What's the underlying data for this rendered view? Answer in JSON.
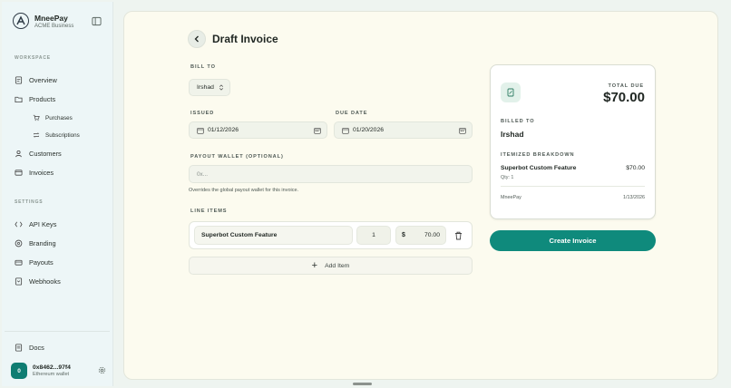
{
  "sidebar": {
    "brand_name": "MneePay",
    "brand_sub": "ACME Business",
    "workspace_label": "WORKSPACE",
    "settings_label": "SETTINGS",
    "items": {
      "overview": "Overview",
      "products": "Products",
      "purchases": "Purchases",
      "subscriptions": "Subscriptions",
      "customers": "Customers",
      "invoices": "Invoices",
      "api_keys": "API Keys",
      "branding": "Branding",
      "payouts": "Payouts",
      "webhooks": "Webhooks",
      "docs": "Docs"
    },
    "wallet": {
      "avatar": "0",
      "address": "0x8462...97f4",
      "network": "Ethereum wallet"
    }
  },
  "page": {
    "title": "Draft Invoice"
  },
  "form": {
    "bill_to_label": "BILL TO",
    "bill_to_value": "Irshad",
    "issued_label": "ISSUED",
    "issued_value": "01/12/2026",
    "due_label": "DUE DATE",
    "due_value": "01/20/2026",
    "wallet_label": "PAYOUT WALLET (OPTIONAL)",
    "wallet_placeholder": "0x...",
    "wallet_hint": "Overrides the global payout wallet for this invoice.",
    "line_items_label": "LINE ITEMS",
    "line_items": [
      {
        "name": "Superbot Custom Feature",
        "qty": "1",
        "currency": "$",
        "price": "70.00"
      }
    ],
    "add_item_label": "Add Item"
  },
  "summary": {
    "total_label": "TOTAL DUE",
    "total_value": "$70.00",
    "billed_label": "BILLED TO",
    "billed_name": "Irshad",
    "breakdown_label": "ITEMIZED BREAKDOWN",
    "item_name": "Superbot Custom Feature",
    "item_qty": "Qty: 1",
    "item_amount": "$70.00",
    "footer_left": "MneePay",
    "footer_right": "1/13/2026"
  },
  "actions": {
    "create_label": "Create Invoice"
  },
  "colors": {
    "accent": "#0f8a7c",
    "sidebar_bg": "#edf6f7",
    "main_bg": "#fcfbef"
  },
  "icons": [
    "app-logo-icon",
    "sidebar-toggle-icon",
    "overview-icon",
    "folder-icon",
    "cart-icon",
    "repeat-icon",
    "user-icon",
    "invoice-icon",
    "code-icon",
    "palette-icon",
    "payout-icon",
    "webhook-icon",
    "docs-icon",
    "gear-icon",
    "back-arrow-icon",
    "chevron-updown-icon",
    "calendar-icon",
    "trash-icon",
    "plus-icon",
    "document-icon"
  ]
}
